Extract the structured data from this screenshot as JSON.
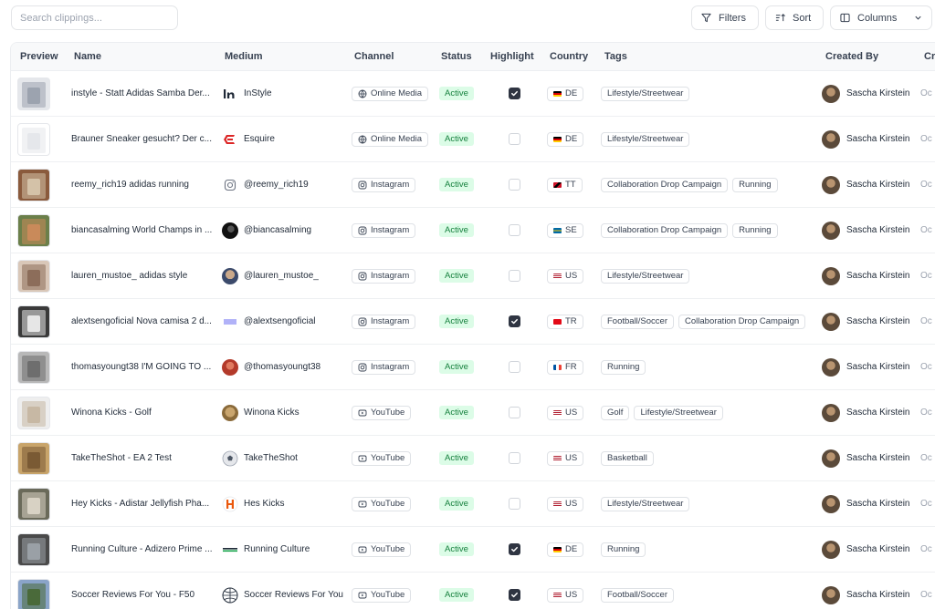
{
  "search": {
    "placeholder": "Search clippings..."
  },
  "toolbar": {
    "filters_label": "Filters",
    "sort_label": "Sort",
    "columns_label": "Columns"
  },
  "columns": {
    "preview": "Preview",
    "name": "Name",
    "medium": "Medium",
    "channel": "Channel",
    "status": "Status",
    "highlight": "Highlight",
    "country": "Country",
    "tags": "Tags",
    "created_by": "Created By",
    "created": "Cr"
  },
  "colors": {
    "status_bg": "#dcfce7",
    "status_text": "#15803d",
    "checkbox_on": "#2f3542",
    "header_bg": "#f8f9fa"
  },
  "rows": [
    {
      "name": "instyle - Statt Adidas Samba Der...",
      "medium": "InStyle",
      "medium_icon": "instyle-logo-icon",
      "channel": "Online Media",
      "channel_icon": "globe-icon",
      "status": "Active",
      "highlight": true,
      "flag": "DE",
      "country": "DE",
      "tags": [
        "Lifestyle/Streetwear"
      ],
      "created_by": "Sascha Kirstein",
      "created": "Oc",
      "thumb": [
        "#e5e7eb",
        "#9ca3af"
      ]
    },
    {
      "name": "Brauner Sneaker gesucht? Der c...",
      "medium": "Esquire",
      "medium_icon": "esquire-logo-icon",
      "channel": "Online Media",
      "channel_icon": "globe-icon",
      "status": "Active",
      "highlight": false,
      "flag": "DE",
      "country": "DE",
      "tags": [
        "Lifestyle/Streetwear"
      ],
      "created_by": "Sascha Kirstein",
      "created": "Oc",
      "thumb": [
        "#ffffff",
        "#e5e7eb"
      ]
    },
    {
      "name": "reemy_rich19 adidas running",
      "medium": "@reemy_rich19",
      "medium_icon": "instagram-icon",
      "channel": "Instagram",
      "channel_icon": "instagram-icon",
      "status": "Active",
      "highlight": false,
      "flag": "TT",
      "country": "TT",
      "tags": [
        "Collaboration Drop Campaign",
        "Running"
      ],
      "created_by": "Sascha Kirstein",
      "created": "Oc",
      "thumb": [
        "#8a5a3c",
        "#d4c2a8"
      ]
    },
    {
      "name": "biancasalming World Champs in ...",
      "medium": "@biancasalming",
      "medium_icon": "avatar-dark-icon",
      "channel": "Instagram",
      "channel_icon": "instagram-icon",
      "status": "Active",
      "highlight": false,
      "flag": "SE",
      "country": "SE",
      "tags": [
        "Collaboration Drop Campaign",
        "Running"
      ],
      "created_by": "Sascha Kirstein",
      "created": "Oc",
      "thumb": [
        "#6b7f4a",
        "#c98a5a"
      ]
    },
    {
      "name": "lauren_mustoe_ adidas style",
      "medium": "@lauren_mustoe_",
      "medium_icon": "avatar-photo-icon",
      "channel": "Instagram",
      "channel_icon": "instagram-icon",
      "status": "Active",
      "highlight": false,
      "flag": "US",
      "country": "US",
      "tags": [
        "Lifestyle/Streetwear"
      ],
      "created_by": "Sascha Kirstein",
      "created": "Oc",
      "thumb": [
        "#d9c7b8",
        "#8c6d5a"
      ]
    },
    {
      "name": "alextsengoficial Nova camisa 2 d...",
      "medium": "@alextsengoficial",
      "medium_icon": "logo-lines-icon",
      "channel": "Instagram",
      "channel_icon": "instagram-icon",
      "status": "Active",
      "highlight": true,
      "flag": "TR",
      "country": "TR",
      "tags": [
        "Football/Soccer",
        "Collaboration Drop Campaign"
      ],
      "created_by": "Sascha Kirstein",
      "created": "Oc",
      "thumb": [
        "#3a3a3a",
        "#e6e6e6"
      ]
    },
    {
      "name": "thomasyoungt38 I'M GOING TO ...",
      "medium": "@thomasyoungt38",
      "medium_icon": "avatar-red-icon",
      "channel": "Instagram",
      "channel_icon": "instagram-icon",
      "status": "Active",
      "highlight": false,
      "flag": "FR",
      "country": "FR",
      "tags": [
        "Running"
      ],
      "created_by": "Sascha Kirstein",
      "created": "Oc",
      "thumb": [
        "#b8b8b8",
        "#6e6e6e"
      ]
    },
    {
      "name": "Winona Kicks - Golf",
      "medium": "Winona Kicks",
      "medium_icon": "avatar-tan-icon",
      "channel": "YouTube",
      "channel_icon": "youtube-icon",
      "status": "Active",
      "highlight": false,
      "flag": "US",
      "country": "US",
      "tags": [
        "Golf",
        "Lifestyle/Streetwear"
      ],
      "created_by": "Sascha Kirstein",
      "created": "Oc",
      "thumb": [
        "#eeeeee",
        "#c7b8a4"
      ]
    },
    {
      "name": "TakeTheShot - EA 2 Test",
      "medium": "TakeTheShot",
      "medium_icon": "soccer-ball-icon",
      "channel": "YouTube",
      "channel_icon": "youtube-icon",
      "status": "Active",
      "highlight": false,
      "flag": "US",
      "country": "US",
      "tags": [
        "Basketball"
      ],
      "created_by": "Sascha Kirstein",
      "created": "Oc",
      "thumb": [
        "#c8a46a",
        "#7a5a34"
      ]
    },
    {
      "name": "Hey Kicks - Adistar Jellyfish Pha...",
      "medium": "Hes Kicks",
      "medium_icon": "hes-logo-icon",
      "channel": "YouTube",
      "channel_icon": "youtube-icon",
      "status": "Active",
      "highlight": false,
      "flag": "US",
      "country": "US",
      "tags": [
        "Lifestyle/Streetwear"
      ],
      "created_by": "Sascha Kirstein",
      "created": "Oc",
      "thumb": [
        "#6a6a5a",
        "#d8d2c4"
      ]
    },
    {
      "name": "Running Culture - Adizero Prime ...",
      "medium": "Running Culture",
      "medium_icon": "logo-stripe-icon",
      "channel": "YouTube",
      "channel_icon": "youtube-icon",
      "status": "Active",
      "highlight": true,
      "flag": "DE",
      "country": "DE",
      "tags": [
        "Running"
      ],
      "created_by": "Sascha Kirstein",
      "created": "Oc",
      "thumb": [
        "#4a4a4a",
        "#9aa0a6"
      ]
    },
    {
      "name": "Soccer Reviews For You - F50",
      "medium": "Soccer Reviews For You",
      "medium_icon": "globe-ball-icon",
      "channel": "YouTube",
      "channel_icon": "youtube-icon",
      "status": "Active",
      "highlight": true,
      "flag": "US",
      "country": "US",
      "tags": [
        "Football/Soccer"
      ],
      "created_by": "Sascha Kirstein",
      "created": "Oc",
      "thumb": [
        "#8aa4c8",
        "#4a6a3a"
      ]
    }
  ]
}
